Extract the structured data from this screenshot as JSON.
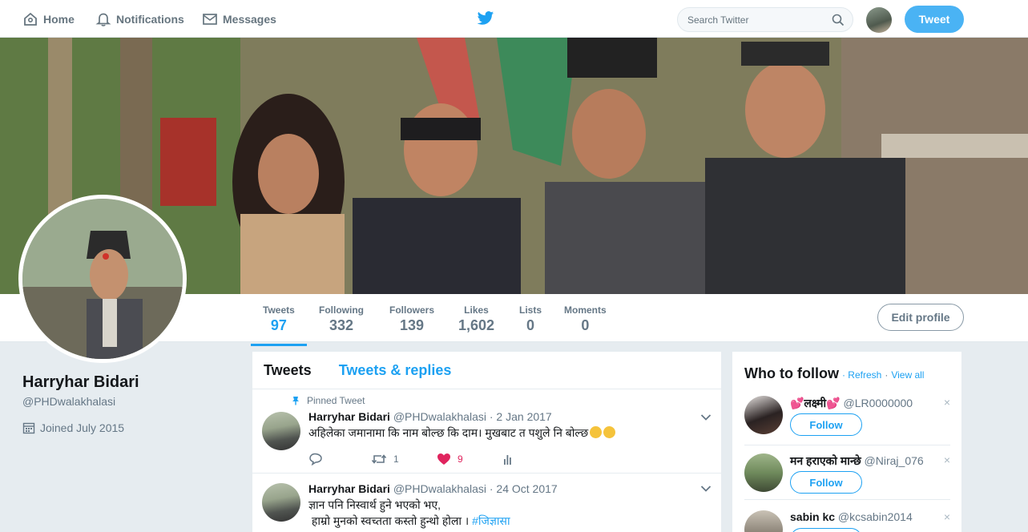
{
  "nav": {
    "home": "Home",
    "notifications": "Notifications",
    "messages": "Messages",
    "search_placeholder": "Search Twitter",
    "tweet_button": "Tweet"
  },
  "profile": {
    "name": "Harryhar Bidari",
    "handle": "@PHDwalakhalasi",
    "joined": "Joined July 2015",
    "edit_button": "Edit profile",
    "stats": [
      {
        "label": "Tweets",
        "value": "97"
      },
      {
        "label": "Following",
        "value": "332"
      },
      {
        "label": "Followers",
        "value": "139"
      },
      {
        "label": "Likes",
        "value": "1,602"
      },
      {
        "label": "Lists",
        "value": "0"
      },
      {
        "label": "Moments",
        "value": "0"
      }
    ]
  },
  "timeline": {
    "tabs": [
      "Tweets",
      "Tweets & replies"
    ],
    "tweets": [
      {
        "pinned": "Pinned Tweet",
        "name": "Harryhar Bidari",
        "handle": "@PHDwalakhalasi",
        "date": "· 2 Jan 2017",
        "text": "अहिलेका जमानामा कि नाम बोल्छ कि दाम। मुखबाट त पशुले नि बोल्छ",
        "retweets": "1",
        "likes": "9"
      },
      {
        "name": "Harryhar Bidari",
        "handle": "@PHDwalakhalasi",
        "date": "· 24 Oct 2017",
        "text_line1": "ज्ञान पनि निस्वार्थ हुने भएको भए,",
        "text_line2": " हाम्रो मुनको स्वच्तता कस्तो हुन्थो होला ।",
        "hashtag": "#जिज्ञासा"
      }
    ]
  },
  "who_to_follow": {
    "title": "Who to follow",
    "refresh": "· Refresh",
    "view_all": "View all",
    "follow_label": "Follow",
    "close": "×",
    "suggestions": [
      {
        "name": "💕लक्ष्मी💕",
        "handle": "@LR0000000"
      },
      {
        "name": "मन हराएको मान्छे",
        "handle": "@Niraj_076"
      },
      {
        "name": "sabin kc",
        "handle": "@kcsabin2014"
      }
    ]
  },
  "colors": {
    "accent": "#1da1f2",
    "tweet_button": "#4ab3f4",
    "like": "#e0245e",
    "background": "#e6ecf0"
  }
}
